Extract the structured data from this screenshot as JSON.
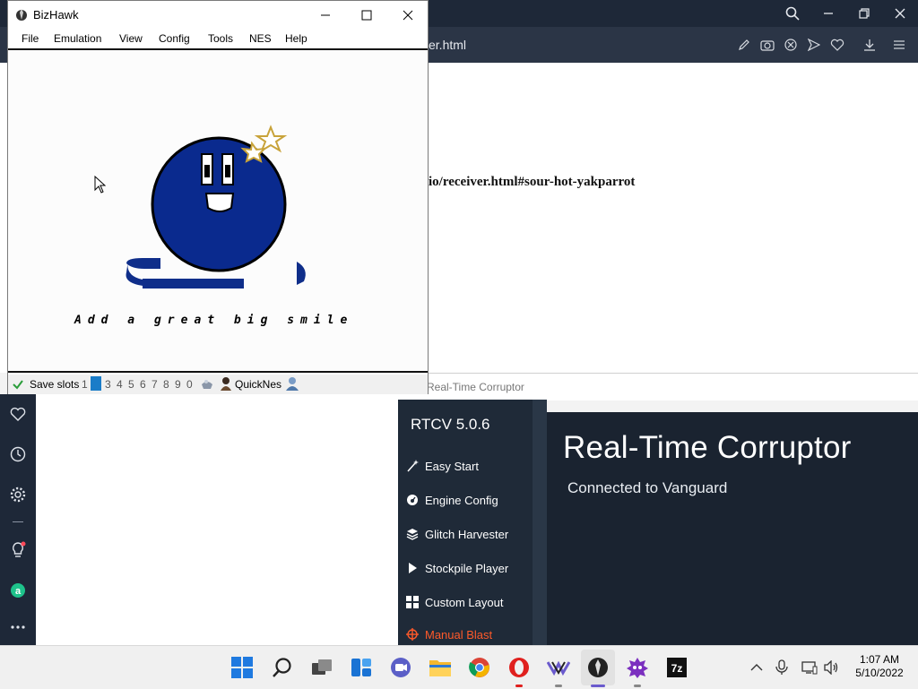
{
  "browser": {
    "address_text": "er.html",
    "page_text": "io/receiver.html#sour-hot-yakparrot"
  },
  "bizhawk": {
    "title": "BizHawk",
    "menu": [
      "File",
      "Emulation",
      "View",
      "Config",
      "Tools",
      "NES",
      "Help"
    ],
    "screen_caption": "Add a great big smile",
    "status": {
      "save_slots_label": "Save slots",
      "slots": [
        "1",
        "2",
        "3",
        "4",
        "5",
        "6",
        "7",
        "8",
        "9",
        "0"
      ],
      "active_slot": "2",
      "core": "QuickNes"
    }
  },
  "rtc": {
    "window_title": "Real-Time Corruptor",
    "version": "RTCV 5.0.6",
    "menu": [
      "Easy Start",
      "Engine Config",
      "Glitch Harvester",
      "Stockpile Player",
      "Custom Layout",
      "Manual Blast"
    ],
    "title": "Real-Time Corruptor",
    "status": "Connected to Vanguard",
    "accent_color": "#ff5a2a"
  },
  "taskbar": {
    "apps": [
      "start-icon",
      "search-icon",
      "task-view-icon",
      "widgets-icon",
      "teams-icon",
      "file-explorer-icon",
      "chrome-icon",
      "opera-icon",
      "vegas-icon",
      "bizhawk-icon",
      "rtc-icon",
      "7zip-icon"
    ],
    "time": "1:07 AM",
    "date": "5/10/2022"
  }
}
